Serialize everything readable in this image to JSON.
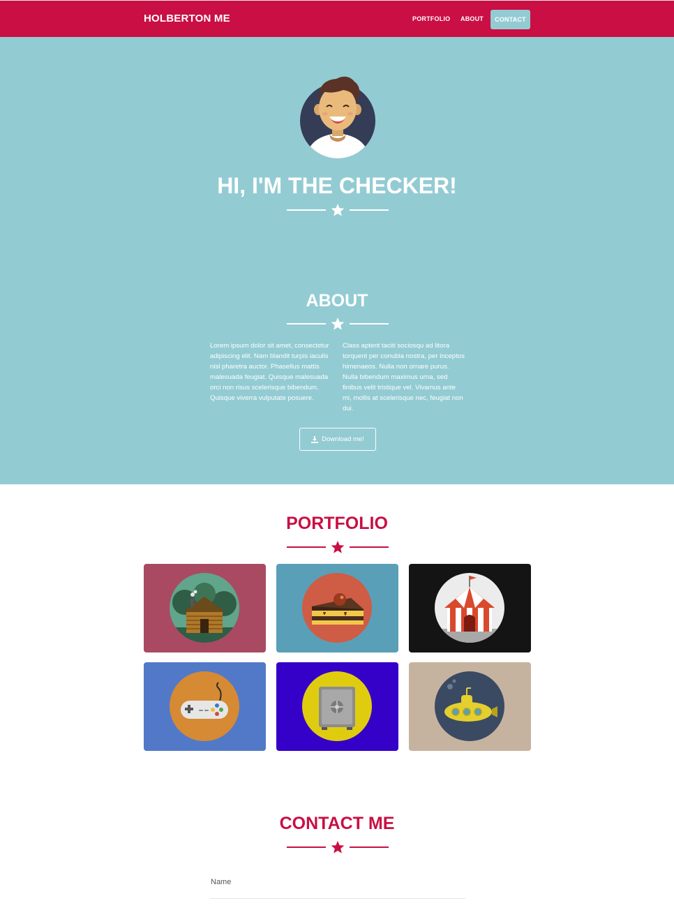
{
  "nav": {
    "brand": "HOLBERTON ME",
    "links": [
      "PORTFOLIO",
      "ABOUT",
      "CONTACT"
    ]
  },
  "hero": {
    "title": "HI, I'M THE CHECKER!",
    "avatar_icon": "smiling-person-avatar-icon"
  },
  "about": {
    "title": "ABOUT",
    "col1": "Lorem ipsum dolor sit amet, consectetur adipiscing elit. Nam blandit turpis iaculis nisl pharetra auctor. Phasellus mattis malesuada feugiat. Quisque malesuada orci non risus scelerisque bibendum. Quisque viverra vulputate posuere.",
    "col2": "Class aptent taciti sociosqu ad litora torquent per conubia nostra, per inceptos himenaeos. Nulla non ornare purus. Nulla bibendum maximus urna, sed finibus velit tristique vel. Vivamus ante mi, mollis at scelerisque nec, feugiat non dui.",
    "download_label": "Download me!"
  },
  "portfolio": {
    "title": "PORTFOLIO",
    "tiles": [
      {
        "icon": "log-cabin-icon",
        "bg": "#a94a62"
      },
      {
        "icon": "cake-slice-icon",
        "bg": "#5a9fb8"
      },
      {
        "icon": "circus-tent-icon",
        "bg": "#141414"
      },
      {
        "icon": "game-controller-icon",
        "bg": "#5179c8"
      },
      {
        "icon": "safe-icon",
        "bg": "#3500c7"
      },
      {
        "icon": "submarine-icon",
        "bg": "#c6b39f"
      }
    ]
  },
  "contact": {
    "title": "CONTACT ME",
    "name_placeholder": "Name"
  },
  "colors": {
    "primary": "#c90f43",
    "secondary": "#93cbd3"
  }
}
